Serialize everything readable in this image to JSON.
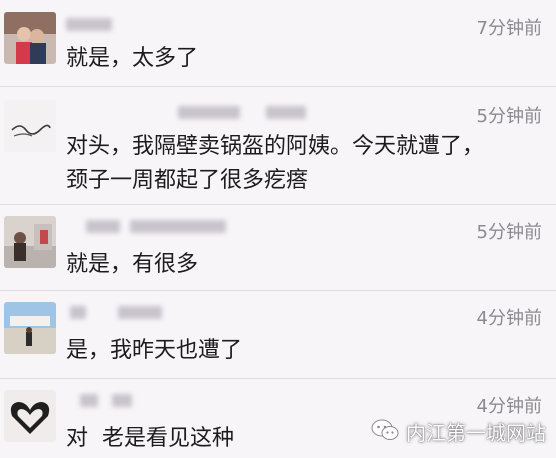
{
  "comments": [
    {
      "time": "7分钟前",
      "text": "就是，太多了"
    },
    {
      "time": "5分钟前",
      "text": "对头，我隔壁卖锅盔的阿姨。今天就遭了，\n颈子一周都起了很多疙瘩"
    },
    {
      "time": "5分钟前",
      "text": "就是，有很多"
    },
    {
      "time": "4分钟前",
      "text": "是，我昨天也遭了"
    },
    {
      "time": "4分钟前",
      "text": "对  老是看见这种"
    }
  ],
  "watermark": {
    "text": "内江第一城网站",
    "icon": "wechat-icon"
  }
}
